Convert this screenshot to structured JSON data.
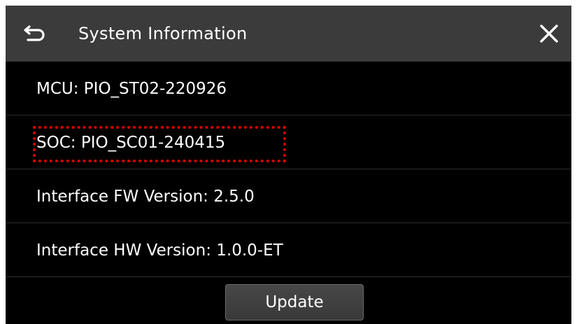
{
  "header": {
    "title": "System Information",
    "back_icon": "back-arrow-icon",
    "close_icon": "close-icon"
  },
  "info_rows": [
    {
      "text": "MCU: PIO_ST02-220926",
      "highlighted": false
    },
    {
      "text": "SOC: PIO_SC01-240415",
      "highlighted": true
    },
    {
      "text": "Interface FW Version: 2.5.0",
      "highlighted": false
    },
    {
      "text": "Interface HW Version: 1.0.0-ET",
      "highlighted": false
    }
  ],
  "footer": {
    "update_label": "Update"
  },
  "colors": {
    "titlebar": "#3b3b3b",
    "background": "#000000",
    "highlight_border": "#e00000",
    "text": "#ffffff"
  }
}
